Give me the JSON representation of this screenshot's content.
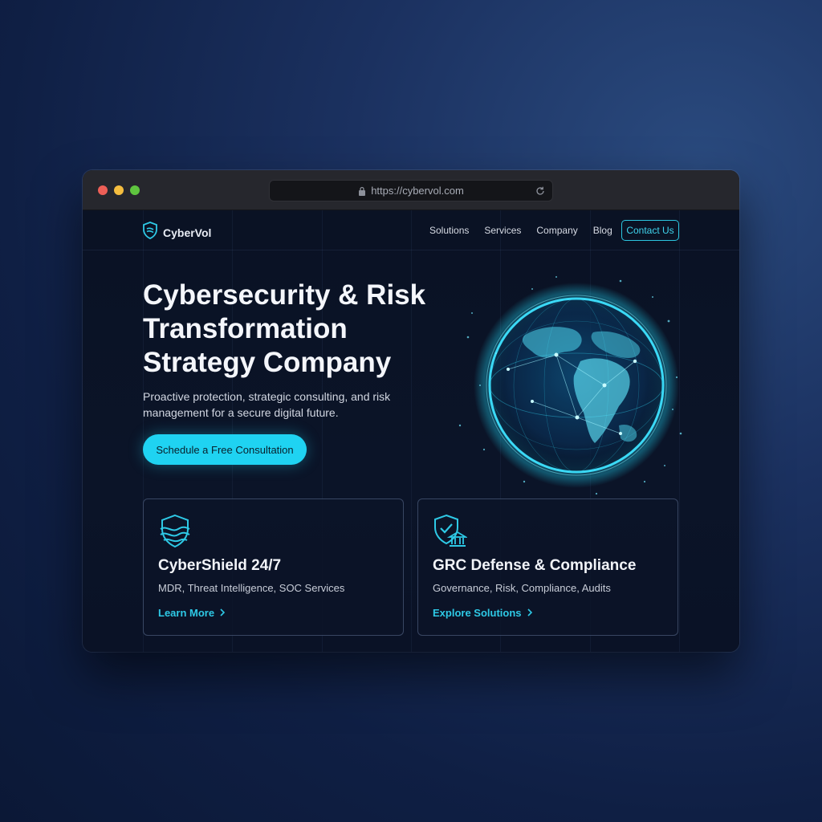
{
  "browser": {
    "url": "https://cybervol.com"
  },
  "nav": {
    "logo_text": "CyberVol",
    "links": [
      "Solutions",
      "Services",
      "Company",
      "Blog"
    ],
    "contact_label": "Contact Us"
  },
  "hero": {
    "title": "Cybersecurity & Risk Transformation Strategy Company",
    "subtitle": "Proactive protection, strategic consulting, and risk management for a secure digital future.",
    "cta_label": "Schedule a Free Consultation"
  },
  "cards": [
    {
      "title": "CyberShield 24/7",
      "description": "MDR, Threat Intelligence, SOC Services",
      "link_label": "Learn More",
      "icon": "shield-waves-icon"
    },
    {
      "title": "GRC Defense & Compliance",
      "description": "Governance, Risk, Compliance, Audits",
      "link_label": "Explore Solutions",
      "icon": "shield-building-icon"
    }
  ],
  "colors": {
    "accent": "#1fd3f2",
    "background": "#0a1224",
    "titlebar": "#26272d"
  }
}
